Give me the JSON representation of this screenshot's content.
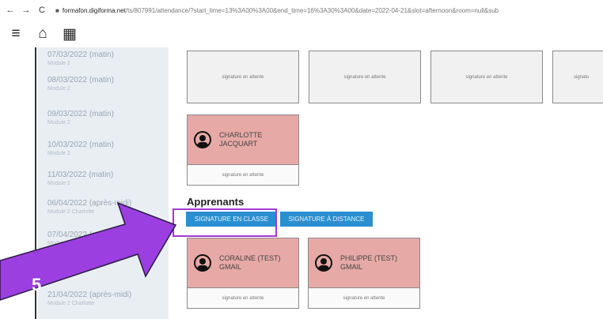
{
  "browser": {
    "back": "←",
    "forward": "→",
    "reload": "C",
    "url_host": "formafon.digiforma.net",
    "url_path": "/ts/807991/attendance/?start_time=13%3A00%3A00&end_time=16%3A30%3A00&date=2022-04-21&slot=afternoon&room=null&sub"
  },
  "toolbar": {
    "menu_icon": "≡",
    "home_icon": "⌂",
    "calendar_icon": "▦"
  },
  "sidebar": {
    "items": [
      {
        "date": "07/03/2022 (matin)",
        "sub": "Module 2"
      },
      {
        "date": "08/03/2022 (matin)",
        "sub": "Module 2"
      },
      {
        "date": "09/03/2022 (matin)",
        "sub": "Module 2"
      },
      {
        "date": "10/03/2022 (matin)",
        "sub": "Module 2"
      },
      {
        "date": "11/03/2022 (matin)",
        "sub": "Module 2"
      },
      {
        "date": "06/04/2022 (après-midi)",
        "sub": "Module 2 Charlotte"
      },
      {
        "date": "07/04/2022 (mat",
        "sub": "Module 2 Ch"
      },
      {
        "date": "21/04/2022 (après-midi)",
        "sub": "Module 2 Charlotte"
      }
    ]
  },
  "main": {
    "top_cards": [
      "signature en attente",
      "signature en attente",
      "signature en attente",
      "signatu"
    ],
    "trainer_card": {
      "name": "CHARLOTTE JACQUART",
      "status": "signature en attente"
    },
    "section_title": "Apprenants",
    "btn_class": "SIGNATURE EN CLASSE",
    "btn_distance": "SIGNATURE À DISTANCE",
    "learners": [
      {
        "name": "CORALINE (TEST) GMAIL",
        "status": "signature en attente"
      },
      {
        "name": "PHILIPPE (TEST) GMAIL",
        "status": "signature en attente"
      }
    ]
  },
  "annotation": {
    "step_number": "5",
    "arrow_color": "#9b3fe0",
    "box_color": "#a238d6"
  },
  "colors": {
    "card_pink": "#e6a9a6",
    "button_blue": "#2a8fd1",
    "sidebar_bg": "#e9eef3"
  }
}
